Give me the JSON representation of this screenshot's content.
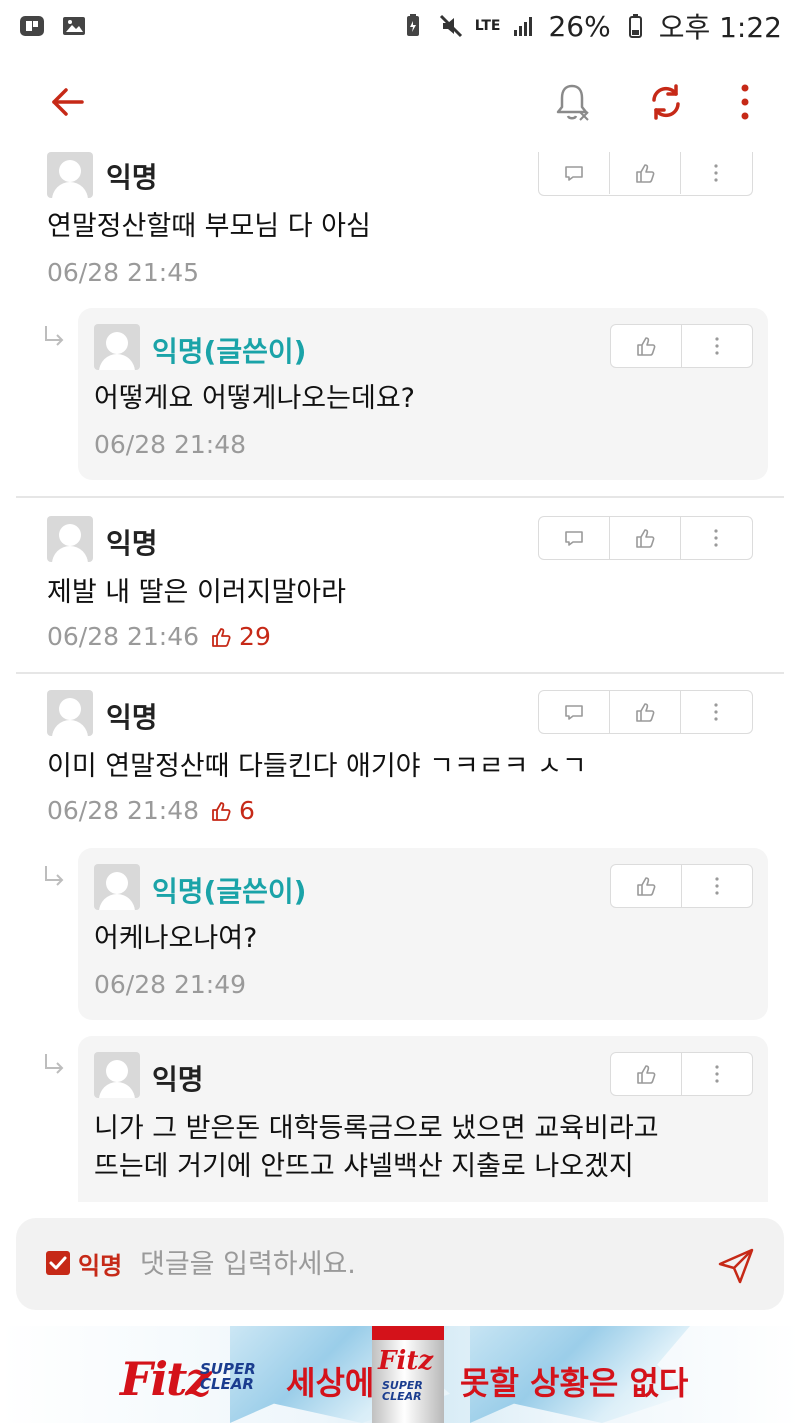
{
  "status_bar": {
    "network": "LTE",
    "battery": "26%",
    "time": "오후 1:22"
  },
  "app_bar": {
    "back_icon": "arrow-left-icon",
    "bell_icon": "bell-off-icon",
    "refresh_icon": "refresh-icon",
    "more_icon": "more-vertical-icon"
  },
  "comments": [
    {
      "author": "익명",
      "text": "연말정산할때 부모님 다 아심",
      "time": "06/28 21:45",
      "replies": [
        {
          "author": "익명(글쓴이)",
          "text": "어떻게요 어떻게나오는데요?",
          "time": "06/28 21:48"
        }
      ]
    },
    {
      "author": "익명",
      "text": "제발 내 딸은 이러지말아라",
      "time": "06/28 21:46",
      "votes": "29"
    },
    {
      "author": "익명",
      "text": "이미 연말정산때 다들킨다 애기야 ㄱㅋㄹㅋ ㅅㄱ",
      "time": "06/28 21:48",
      "votes": "6",
      "replies": [
        {
          "author": "익명(글쓴이)",
          "text": "어케나오나여?",
          "time": "06/28 21:49"
        },
        {
          "author": "익명",
          "text_line1": "니가 그 받은돈 대학등록금으로 냈으면 교육비라고",
          "text_line2": "뜨는데 거기에 안뜨고 샤넬백산 지출로 나오겠지"
        }
      ]
    }
  ],
  "input": {
    "anon_label": "익명",
    "placeholder": "댓글을 입력하세요."
  },
  "ad": {
    "brand": "Fitz",
    "sub_line1": "SUPER",
    "sub_line2": "CLEAR",
    "slogan_part1": "세상에",
    "slogan_part2": "못할 상황은 없다"
  },
  "colors": {
    "accent": "#c62917",
    "op_name": "#1aa3a8",
    "meta": "#9a9a9a"
  }
}
